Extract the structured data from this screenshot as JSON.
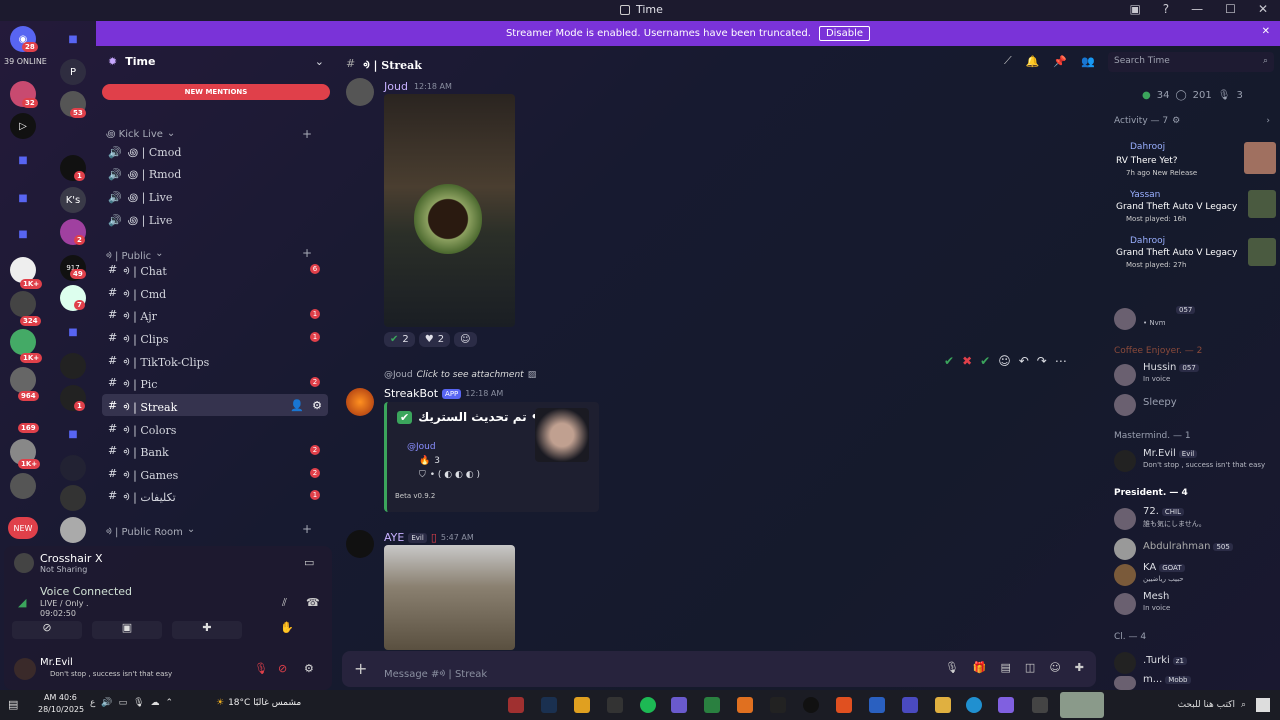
{
  "window": {
    "title": "Time"
  },
  "banner": {
    "text": "Streamer Mode is enabled. Usernames have been truncated.",
    "button": "Disable"
  },
  "servers": {
    "online": "39 ONLINE",
    "b1": "28",
    "b2": "32",
    "b3": "53",
    "b4": "1",
    "b5": "2",
    "b6": "49",
    "b7": "7",
    "b8": "1K+",
    "b9": "324",
    "b10": "1K+",
    "b11": "964",
    "b12": "1",
    "b13": "169",
    "b14": "1K+",
    "p": "P",
    "ks": "K's",
    "new": "NEW"
  },
  "guild": {
    "name": "Time",
    "new_mentions": "NEW MENTIONS"
  },
  "categories": {
    "kick": "꩜ Kick Live",
    "public": "ᢀ | Public",
    "public_room": "ᢀ | Public Room"
  },
  "channels": {
    "cmod": "꩜ | Cmod",
    "rmod": "꩜ | Rmod",
    "live1": "꩜ | Live",
    "live2": "꩜ | Live",
    "chat": "ᢀ | Chat",
    "chat_c": "6",
    "cmd": "ᢀ | Cmd",
    "ajr": "ᢀ | Ajr",
    "ajr_c": "1",
    "clips": "ᢀ | Clips",
    "clips_c": "1",
    "tiktok": "ᢀ | TikTok-Clips",
    "pic": "ᢀ | Pic",
    "pic_c": "2",
    "streak": "ᢀ | Streak",
    "colors": "ᢀ | Colors",
    "bank": "ᢀ | Bank",
    "bank_c": "2",
    "games": "ᢀ | Games",
    "games_c": "2",
    "takleef": "ᢀ | تكليفات",
    "takleef_c": "1"
  },
  "user_panel": {
    "activity": "Crosshair X",
    "activity_sub": "Not Sharing",
    "voice": "Voice Connected",
    "voice_sub": "LIVE / Only .",
    "timer": "09:02:50",
    "user": "Mr.Evil",
    "status": "Don't stop , success isn't that easy"
  },
  "header": {
    "channel": "ᢀ | Streak",
    "search": "Search Time"
  },
  "messages": {
    "m1": {
      "author": "Joud",
      "time": "12:18 AM",
      "r1": "2",
      "r2": "2"
    },
    "m2": {
      "reply_user": "@Joud",
      "reply_text": "Click to see attachment",
      "author": "StreakBot",
      "tag": "APP",
      "time": "12:18 AM",
      "embed_title": "تم تحديث الستريك •",
      "mention": "@Joud",
      "count": "3",
      "footer": "Beta v0.9.2"
    },
    "m3": {
      "author": "AYE",
      "tag": "Evil",
      "time": "5:47 AM"
    }
  },
  "composer": {
    "placeholder": "Message #ᢀ | Streak"
  },
  "members_head": {
    "online": "34",
    "idle": "201",
    "voice": "3",
    "activity": "Activity — 7"
  },
  "activity": [
    {
      "user": "Dahrooj",
      "title": "RV There Yet?",
      "sub": "7h ago  New Release"
    },
    {
      "user": "Yassan",
      "title": "Grand Theft Auto V Legacy",
      "sub": "Most played: 16h"
    },
    {
      "user": "Dahrooj",
      "title": "Grand Theft Auto V Legacy",
      "sub": "Most played: 27h"
    }
  ],
  "members": {
    "m0_tag": "057",
    "m0_s": "• Nvm",
    "sec1": "Coffee Enjoyer. — 2",
    "hussin": "Hussin",
    "hussin_tag": "057",
    "hussin_s": "In voice",
    "sleepy": "Sleepy",
    "sec2": "Mastermind. — 1",
    "evil": "Mr.Evil",
    "evil_tag": "Evil",
    "evil_s": "Don't stop , success isn't that easy",
    "sec3": "President. — 4",
    "p72": "72.",
    "p72_tag": "CHIL",
    "p72_s": "誰も気にしません。",
    "abd": "Abdulrahman",
    "abd_tag": "505",
    "ka": "KA",
    "ka_tag": "GOAT",
    "ka_s": "حبيب رياضيين",
    "mesh": "Mesh",
    "mesh_s": "In voice",
    "sec4": "Cl. — 4",
    "turki": ".Turki",
    "turki_tag": "z1",
    "mm": "m...",
    "mm_tag": "Mobb"
  },
  "taskbar": {
    "time": "AM 40:6",
    "date": "28/10/2025",
    "weather": "18°C  مشمس غالبًا",
    "search": "اكتب هنا للبحث"
  },
  "colors": {
    "accent": "#7a33d8",
    "mention": "#e0404a",
    "online": "#3ba55c"
  }
}
